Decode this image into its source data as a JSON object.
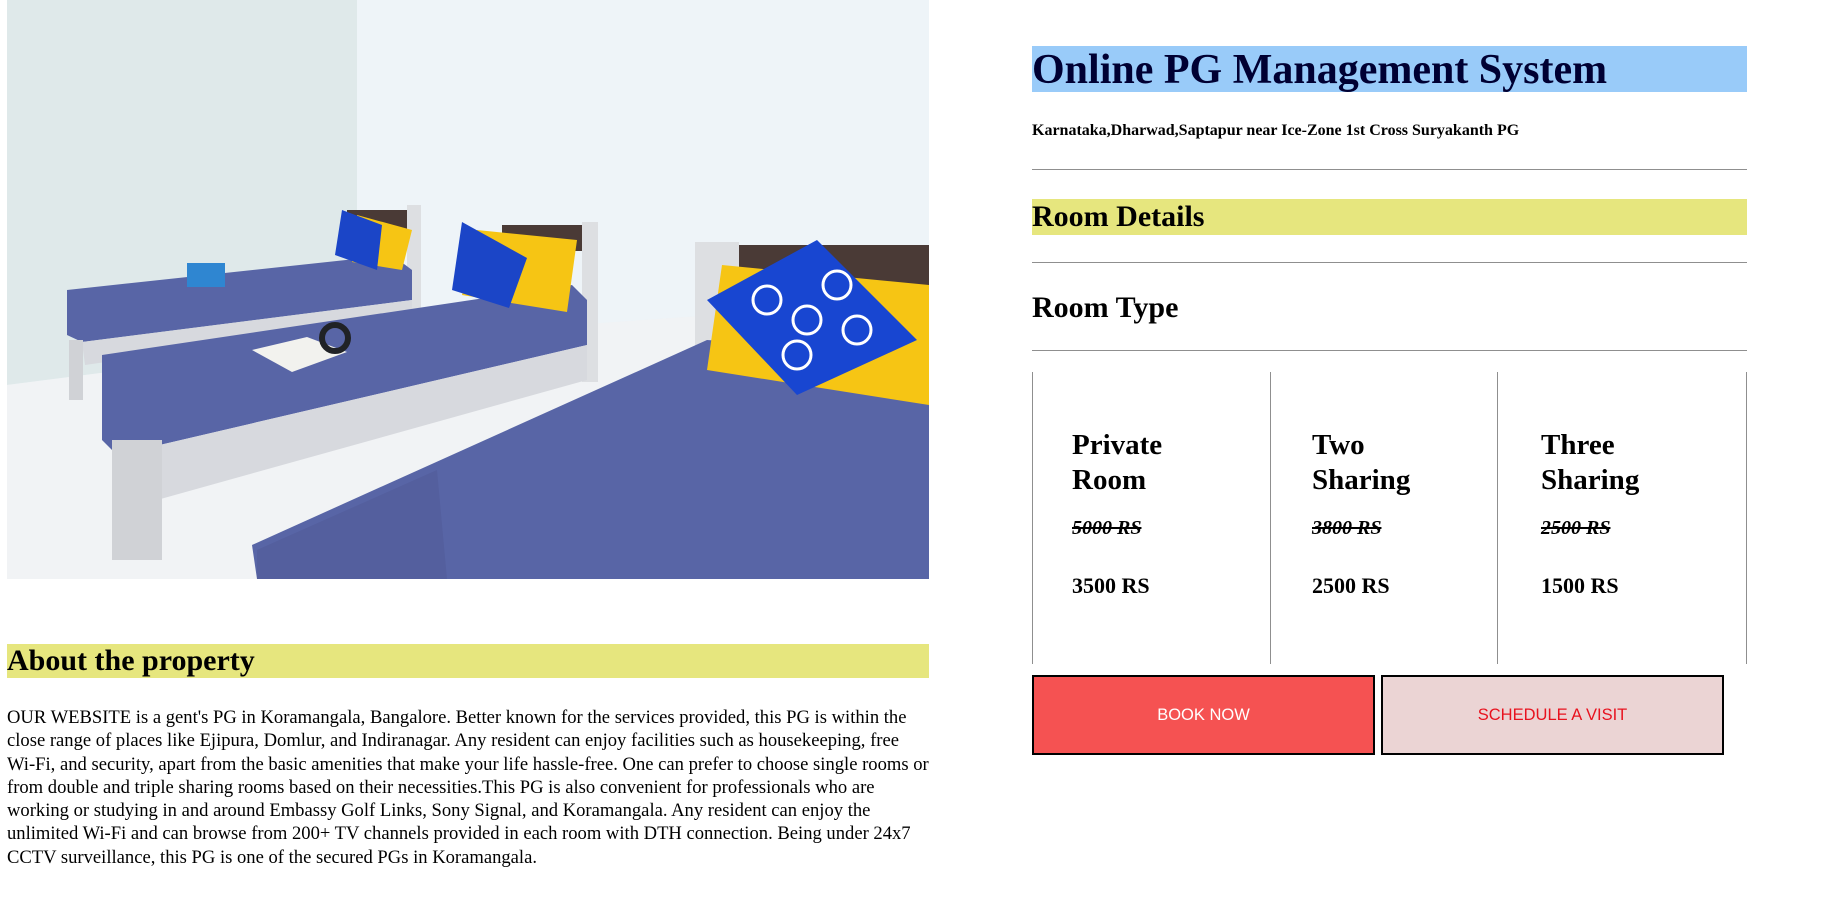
{
  "photo": {
    "alt": "PG room with three single beds"
  },
  "about": {
    "title": "About the property",
    "text": "OUR WEBSITE is a gent's PG in Koramangala, Bangalore. Better known for the services provided, this PG is within the close range of places like Ejipura, Domlur, and Indiranagar. Any resident can enjoy facilities such as housekeeping, free Wi-Fi, and security, apart from the basic amenities that make your life hassle-free. One can prefer to choose single rooms or from double and triple sharing rooms based on their necessities.This PG is also convenient for professionals who are working or studying in and around Embassy Golf Links, Sony Signal, and Koramangala. Any resident can enjoy the unlimited Wi-Fi and can browse from 200+ TV channels provided in each room with DTH connection. Being under 24x7 CCTV surveillance, this PG is one of the secured PGs in Koramangala."
  },
  "header": {
    "title": "Online PG Management System",
    "address": "Karnataka,Dharwad,Saptapur near Ice-Zone 1st Cross Suryakanth PG"
  },
  "room_details": {
    "title": "Room Details",
    "room_type_label": "Room Type"
  },
  "plans": [
    {
      "name": "Private Room",
      "old_price": "5000 RS",
      "new_price": "3500 RS"
    },
    {
      "name": "Two Sharing",
      "old_price": "3800 RS",
      "new_price": "2500 RS"
    },
    {
      "name": "Three Sharing",
      "old_price": "2500 RS",
      "new_price": "1500 RS"
    }
  ],
  "actions": {
    "book": "BOOK NOW",
    "visit": "SCHEDULE A VISIT"
  },
  "colors": {
    "title_bg": "#99cbf9",
    "section_bg": "#e6e67e",
    "book_bg": "#f55252",
    "visit_bg": "#ebd4d4",
    "visit_text": "#e8121e"
  }
}
